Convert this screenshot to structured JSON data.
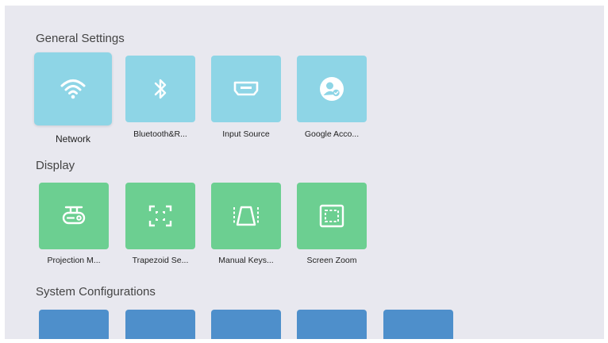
{
  "sections": {
    "general": {
      "title": "General Settings",
      "tiles": [
        {
          "label": "Network",
          "icon": "wifi-icon"
        },
        {
          "label": "Bluetooth&R...",
          "icon": "bluetooth-icon"
        },
        {
          "label": "Input Source",
          "icon": "hdmi-port-icon"
        },
        {
          "label": "Google Acco...",
          "icon": "account-icon"
        }
      ]
    },
    "display": {
      "title": "Display",
      "tiles": [
        {
          "label": "Projection M...",
          "icon": "projector-icon"
        },
        {
          "label": "Trapezoid Se...",
          "icon": "trapezoid-focus-icon"
        },
        {
          "label": "Manual Keys...",
          "icon": "keystone-icon"
        },
        {
          "label": "Screen Zoom",
          "icon": "screen-zoom-icon"
        }
      ]
    },
    "system": {
      "title": "System Configurations"
    }
  },
  "colors": {
    "background": "#e8e8ef",
    "general_tile": "#8ed5e6",
    "display_tile": "#6ccf91",
    "system_tile": "#4e8fcb",
    "icon": "#ffffff"
  }
}
